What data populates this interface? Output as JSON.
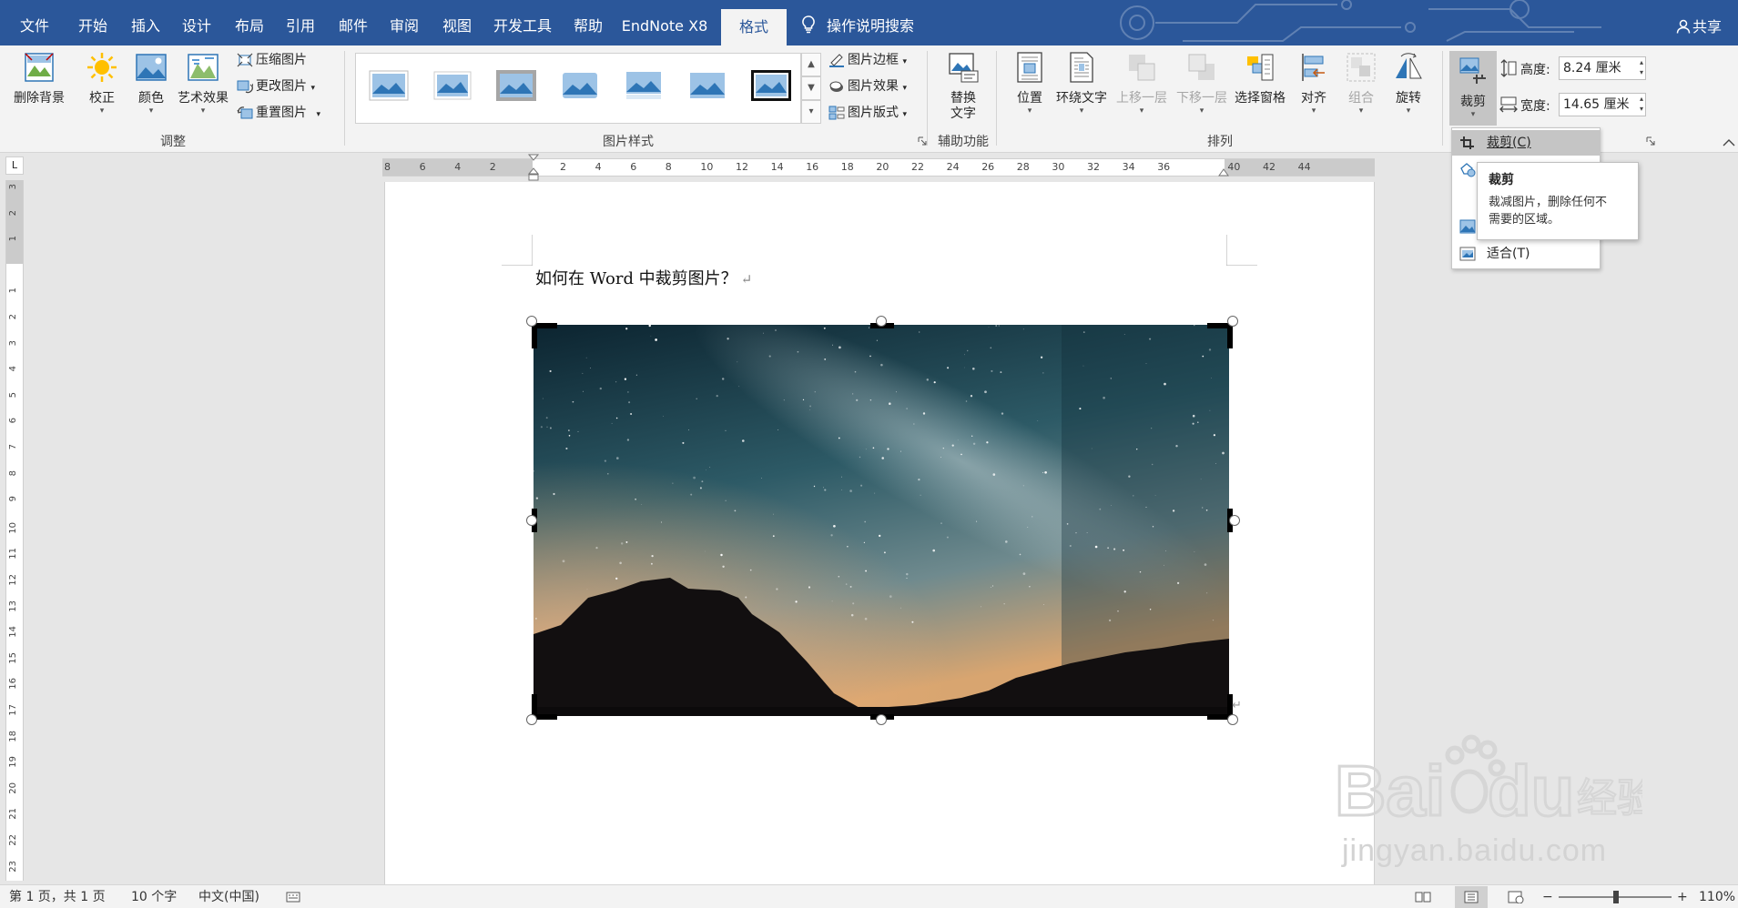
{
  "tabs": [
    "文件",
    "开始",
    "插入",
    "设计",
    "布局",
    "引用",
    "邮件",
    "审阅",
    "视图",
    "开发工具",
    "帮助",
    "EndNote X8",
    "格式"
  ],
  "active_tab": "格式",
  "search_tab": "操作说明搜索",
  "share": "共享",
  "ribbon": {
    "adjust": {
      "remove_bg": "删除背景",
      "correct": "校正",
      "color": "颜色",
      "art": "艺术效果",
      "compress": "压缩图片",
      "change": "更改图片",
      "reset": "重置图片",
      "label": "调整"
    },
    "styles": {
      "border": "图片边框",
      "effect": "图片效果",
      "layout": "图片版式",
      "label": "图片样式"
    },
    "aux": {
      "alt_line1": "替换",
      "alt_line2": "文字",
      "label": "辅助功能"
    },
    "arrange": {
      "position": "位置",
      "wrap": "环绕文字",
      "forward": "上移一层",
      "backward": "下移一层",
      "pane": "选择窗格",
      "align": "对齐",
      "group": "组合",
      "rotate": "旋转",
      "label": "排列"
    },
    "size": {
      "crop": "裁剪",
      "height_label": "高度:",
      "height_value": "8.24 厘米",
      "width_label": "宽度:",
      "width_value": "14.65 厘米"
    }
  },
  "crop_menu": {
    "item_crop": "裁剪(C)",
    "item_fit": "适合(T)"
  },
  "tooltip": {
    "title": "裁剪",
    "line1": "裁减图片，删除任何不",
    "line2": "需要的区域。"
  },
  "document": {
    "text": "如何在 Word 中裁剪图片？"
  },
  "watermark": "jingyan.baidu.com",
  "statusbar": {
    "page": "第 1 页，共 1 页",
    "words": "10 个字",
    "lang": "中文(中国)",
    "zoom": "110%"
  },
  "hruler_ticks": [
    "8",
    "6",
    "4",
    "2",
    "",
    "2",
    "4",
    "6",
    "8",
    "10",
    "12",
    "14",
    "16",
    "18",
    "20",
    "22",
    "24",
    "26",
    "28",
    "30",
    "32",
    "34",
    "36",
    "",
    "40",
    "42",
    "44"
  ],
  "vruler_ticks": [
    "3",
    "2",
    "1",
    "",
    "1",
    "2",
    "3",
    "4",
    "5",
    "6",
    "7",
    "8",
    "9",
    "10",
    "11",
    "12",
    "13",
    "14",
    "15",
    "16",
    "17",
    "18",
    "19",
    "20",
    "21",
    "22",
    "23"
  ]
}
